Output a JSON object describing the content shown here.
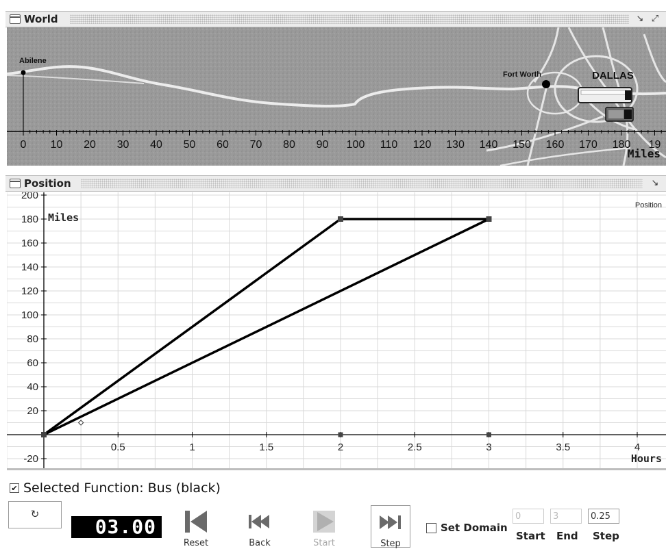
{
  "world": {
    "title": "World",
    "abilene": "Abilene",
    "fort_worth": "Fort Worth",
    "dallas": "DALLAS",
    "axis_label": "Miles",
    "ticks": [
      "0",
      "10",
      "20",
      "30",
      "40",
      "50",
      "60",
      "70",
      "80",
      "90",
      "100",
      "110",
      "120",
      "130",
      "140",
      "150",
      "160",
      "170",
      "180",
      "19"
    ]
  },
  "position": {
    "title": "Position",
    "legend": "Position",
    "ylabel": "Miles",
    "xlabel": "Hours"
  },
  "chart_data": {
    "type": "line",
    "xlabel": "Hours",
    "ylabel": "Miles",
    "xlim": [
      -0.25,
      4.2
    ],
    "ylim": [
      -25,
      200
    ],
    "x_ticks": [
      "0.5",
      "1",
      "1.5",
      "2",
      "2.5",
      "3",
      "3.5",
      "4"
    ],
    "y_ticks": [
      "200",
      "180",
      "160",
      "140",
      "120",
      "100",
      "80",
      "60",
      "40",
      "20",
      "-20"
    ],
    "series": [
      {
        "points": [
          [
            0,
            0
          ],
          [
            2,
            180
          ],
          [
            3,
            180
          ]
        ]
      },
      {
        "points": [
          [
            0,
            0
          ],
          [
            3,
            180
          ]
        ]
      }
    ]
  },
  "selected_function": {
    "checked": "✔",
    "label": "Selected Function: Bus (black)"
  },
  "controls": {
    "refresh_icon": "↻",
    "clock": "03.00",
    "reset": "Reset",
    "back": "Back",
    "start": "Start",
    "step": "Step",
    "set_domain": "Set Domain",
    "start_value": "0",
    "end_value": "3",
    "step_value": "0.25",
    "start_label": "Start",
    "end_label": "End",
    "step_label": "Step"
  }
}
